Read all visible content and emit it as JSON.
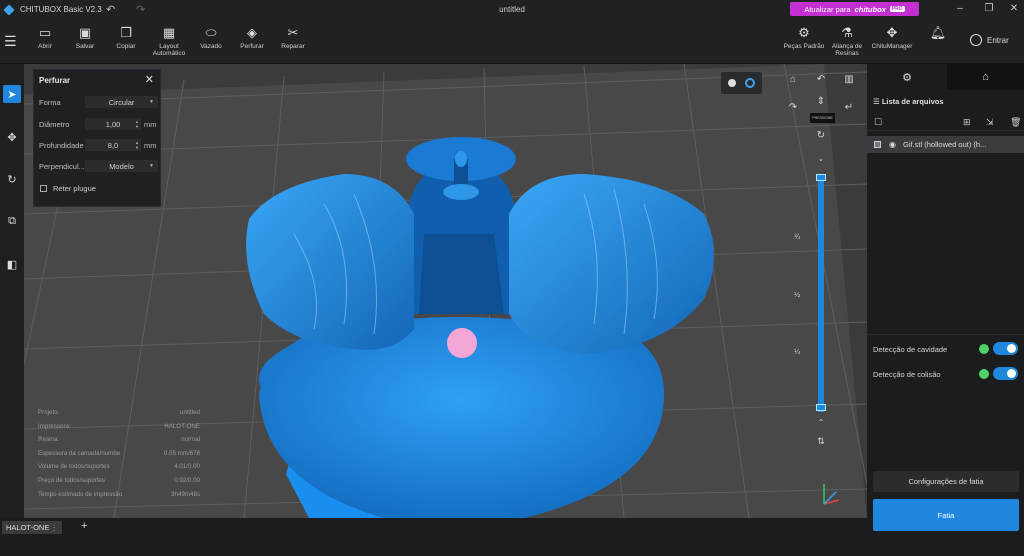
{
  "app": {
    "title": "CHITUBOX Basic V2.3",
    "window_title": "untitled",
    "upgrade_label": "Atualizar para",
    "upgrade_brand": "chitubox",
    "upgrade_badge": "PRO"
  },
  "toolbar": {
    "items": [
      {
        "label": "Abrir",
        "icon": "folder-icon"
      },
      {
        "label": "Salvar",
        "icon": "save-icon"
      },
      {
        "label": "Copiar",
        "icon": "copy-icon"
      },
      {
        "label": "Layout Automático",
        "icon": "layout-icon"
      },
      {
        "label": "Vazado",
        "icon": "hollow-icon"
      },
      {
        "label": "Perfurar",
        "icon": "drill-icon"
      },
      {
        "label": "Reparar",
        "icon": "repair-icon"
      }
    ],
    "right_items": [
      {
        "label": "Peças Padrão",
        "icon": "parts-icon"
      },
      {
        "label": "Aliança de Resinas",
        "icon": "resin-icon"
      },
      {
        "label": "ChituManager",
        "icon": "manager-icon"
      }
    ],
    "login_label": "Entrar"
  },
  "perfurar_panel": {
    "title": "Perfurar",
    "forma_label": "Forma",
    "forma_value": "Circular",
    "diametro_label": "Diâmetro",
    "diametro_value": "1,00",
    "diametro_unit": "mm",
    "profundidade_label": "Profundidade",
    "profundidade_value": "8,0",
    "profundidade_unit": "mm",
    "perpendicular_label": "Perpendicul...",
    "perpendicular_value": "Modelo",
    "reter_label": "Reter plugue"
  },
  "info": [
    {
      "k": "Projeto:",
      "v": "untitled"
    },
    {
      "k": "Impressora:",
      "v": "HALOT-ONE"
    },
    {
      "k": "Resina:",
      "v": "normal"
    },
    {
      "k": "Espessura da camada/numbe",
      "v": "0.05 mm/678"
    },
    {
      "k": "Volume de todos/suportes",
      "v": "4.01/0.00"
    },
    {
      "k": "Preço de todos/suportes",
      "v": "0.92/0.00"
    },
    {
      "k": "Tempo estimado de impressão",
      "v": "3h49m48s"
    }
  ],
  "slider": {
    "fractions": [
      "¾",
      "½",
      "¼"
    ],
    "tooltip": "PRESSIONE",
    "level": 1.0
  },
  "right_panel": {
    "list_header": "Lista de arquivos",
    "file_name": "Gif.stl (hollowed out) (h...",
    "cavity_label": "Detecção de cavidade",
    "collision_label": "Detecção de colisão",
    "config_label": "Configurações de fatia",
    "slice_label": "Fatia"
  },
  "bottom": {
    "printer_tab": "HALOT-ONE",
    "add": "+"
  },
  "colors": {
    "accent": "#1f87dd",
    "model": "#1e8ce6",
    "upgrade": "#c42fd1",
    "marker": "#f4a6d7"
  }
}
